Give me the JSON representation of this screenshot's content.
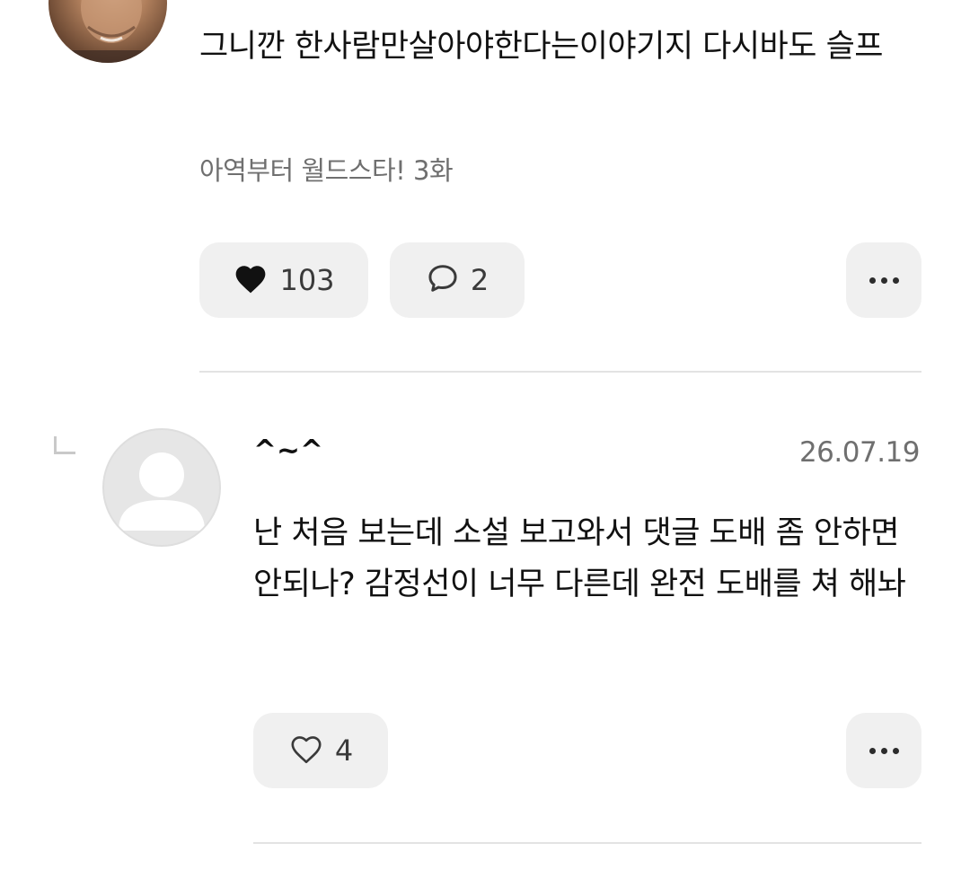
{
  "comment1": {
    "text": "그니깐 한사람만살아야한다는이야기지 다시바도 슬프",
    "episode": "아역부터 월드스타! 3화",
    "like_count": "103",
    "reply_count": "2"
  },
  "reply": {
    "username": "^~^",
    "date": "26.07.19",
    "text": "난 처음 보는데 소설 보고와서 댓글 도배 좀 안하면 안되나? 감정선이 너무 다른데 완전 도배를 쳐 해놔",
    "like_count": "4"
  },
  "icons": {
    "like_filled": "heart-filled-icon",
    "like_outline": "heart-outline-icon",
    "reply": "speech-bubble-icon",
    "more": "more-dots-icon",
    "reply_indicator": "reply-corner-icon"
  },
  "colors": {
    "pill_background": "#f0f0f0",
    "divider": "#e3e3e3",
    "muted_text": "#6f6f6f"
  }
}
